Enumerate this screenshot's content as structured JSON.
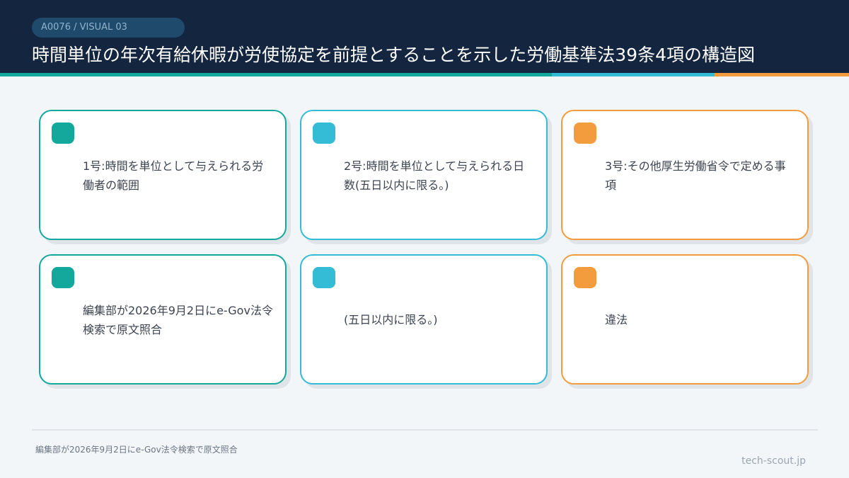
{
  "header": {
    "tag": "A0076 / VISUAL 03",
    "title": "時間単位の年次有給休暇が労使協定を前提とすることを示した労働基準法39条4項の構造図"
  },
  "colors": {
    "header_bg": "#13253f",
    "teal": "#12a89c",
    "blue": "#34bcd6",
    "orange": "#f39c3d"
  },
  "cards": [
    {
      "text": "1号:時間を単位として与えられる労働者の範囲",
      "accent": "teal"
    },
    {
      "text": "2号:時間を単位として与えられる日数(五日以内に限る。)",
      "accent": "blue"
    },
    {
      "text": "3号:その他厚生労働省令で定める事項",
      "accent": "orange"
    },
    {
      "text": "編集部が2026年9月2日にe-Gov法令検索で原文照合",
      "accent": "teal"
    },
    {
      "text": "(五日以内に限る。)",
      "accent": "blue"
    },
    {
      "text": "違法",
      "accent": "orange"
    }
  ],
  "footer": {
    "note": "編集部が2026年9月2日にe-Gov法令検索で原文照合",
    "site": "tech-scout.jp"
  }
}
